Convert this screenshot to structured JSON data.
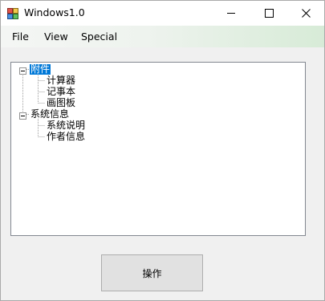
{
  "window": {
    "title": "Windows1.0",
    "icon": "app-window-icon",
    "controls": [
      "minimize-icon",
      "maximize-icon",
      "close-icon"
    ]
  },
  "menu": {
    "file": "File",
    "view": "View",
    "special": "Special"
  },
  "tree": {
    "nodes": [
      {
        "label": "附件",
        "expanded": true,
        "selected": true,
        "children": [
          "计算器",
          "记事本",
          "画图板"
        ]
      },
      {
        "label": "系统信息",
        "expanded": true,
        "selected": false,
        "children": [
          "系统说明",
          "作者信息"
        ]
      }
    ]
  },
  "action_button": {
    "label": "操作"
  },
  "colors": {
    "selection": "#0078d7",
    "menubar_gradient_end": "#d7ebd7",
    "window_bg": "#f0f0f0"
  }
}
